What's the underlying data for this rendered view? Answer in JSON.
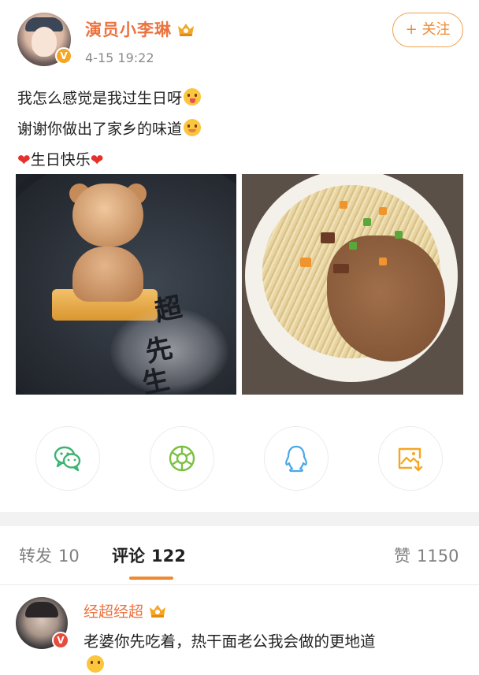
{
  "post": {
    "author": "演员小李琳",
    "verified_badge": "V",
    "timestamp": "4-15 19:22",
    "follow_label": "+ 关注",
    "lines": [
      "我怎么感觉是我过生日呀",
      "谢谢你做出了家乡的味道",
      "生日快乐"
    ],
    "photo_left_text": [
      "超",
      "先",
      "生"
    ],
    "photo_left_icon": "teddy-bear-cookie-photo",
    "photo_right_icon": "hot-dry-noodles-photo"
  },
  "share": {
    "items": [
      {
        "name": "wechat",
        "icon": "wechat-icon",
        "color": "#3cb371"
      },
      {
        "name": "moments",
        "icon": "moments-icon",
        "color": "#7cc042"
      },
      {
        "name": "qq",
        "icon": "qq-icon",
        "color": "#4aa8e8"
      },
      {
        "name": "save-image",
        "icon": "save-image-icon",
        "color": "#f5a623"
      }
    ]
  },
  "tabs": {
    "repost_label": "转发",
    "repost_count": "10",
    "comments_label": "评论",
    "comments_count": "122",
    "likes_label": "赞",
    "likes_count": "1150"
  },
  "comment": {
    "author": "经超经超",
    "verified_badge": "V",
    "text": "老婆你先吃着，热干面老公我会做的更地道"
  },
  "colors": {
    "accent": "#f08a30",
    "username": "#eb7340",
    "heart": "#e4312c"
  }
}
